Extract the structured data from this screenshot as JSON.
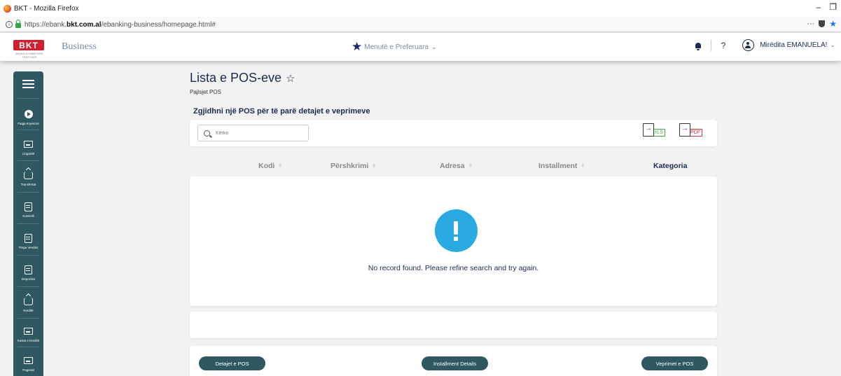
{
  "browser": {
    "window_title": "BKT - Mozilla Firefox",
    "url_prefix": "https://ebank.",
    "url_domain": "bkt.com.al",
    "url_suffix": "/ebanking-business/homepage.html#",
    "min": "–",
    "max": "❐",
    "more": "···"
  },
  "header": {
    "logo": "BKT",
    "logo_sub": "BANKA KOMBETARE TREGTARE",
    "business": "Business",
    "favorites": "Menutë e Preferuara",
    "help": "?",
    "user": "Mirëdita EMANUELA!"
  },
  "sidebar": {
    "items": [
      {
        "label": "Faqja Kryesore",
        "icon": "navigate-icon"
      },
      {
        "label": "Llogaritë",
        "icon": "account-card-icon"
      },
      {
        "label": "Transfertat",
        "icon": "transfer-icon"
      },
      {
        "label": "Kontrolli",
        "icon": "document-icon"
      },
      {
        "label": "Tregu Vendas",
        "icon": "document-icon"
      },
      {
        "label": "Depozitat",
        "icon": "document-icon"
      },
      {
        "label": "Kreditë",
        "icon": "transfer-icon"
      },
      {
        "label": "Kartat e Kreditit",
        "icon": "account-card-icon"
      },
      {
        "label": "Pagesat",
        "icon": "account-card-icon"
      }
    ]
  },
  "page": {
    "title": "Lista e POS-eve",
    "subtitle": "Pajisjet POS",
    "section_title": "Zgjidhni një POS për të parë detajet e veprimeve",
    "search_placeholder": "Kërko",
    "export_xls": "XLS",
    "export_pdf": "PDF",
    "columns": [
      "Kodi",
      "Përshkrimi",
      "Adresa",
      "Installment",
      "Kategoria"
    ],
    "sort_glyph": "⇳",
    "empty_message": "No record found. Please refine search and try again.",
    "actions": [
      "Detajet e POS",
      "Installment Details",
      "Veprimet e POS"
    ]
  },
  "colors": {
    "sidebar_bg": "#2e5960",
    "accent_navy": "#1b2a4e",
    "alert_blue": "#29abe2",
    "brand_red": "#d01f2f"
  }
}
